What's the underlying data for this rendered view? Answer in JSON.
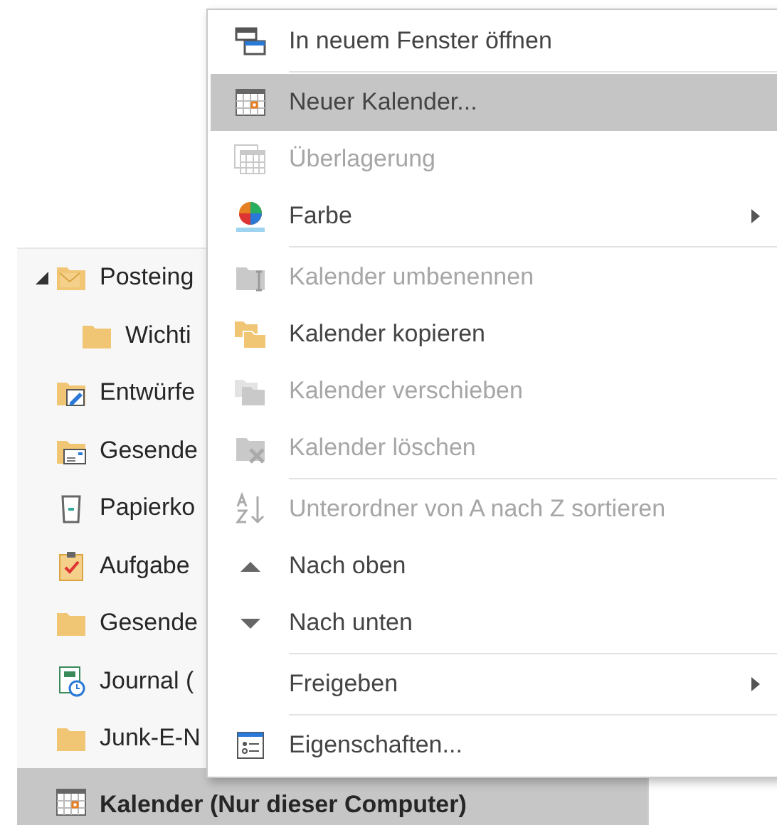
{
  "folder_pane": {
    "items": [
      {
        "label": "Posteing",
        "kind": "inbox",
        "expanded": true,
        "selected": false,
        "children": [
          {
            "label": "Wichti",
            "kind": "folder",
            "selected": false
          }
        ]
      },
      {
        "label": "Entwürfe",
        "kind": "drafts",
        "selected": false
      },
      {
        "label": "Gesende",
        "kind": "sent",
        "selected": false
      },
      {
        "label": "Papierko",
        "kind": "trash",
        "selected": false
      },
      {
        "label": "Aufgabe",
        "kind": "tasks",
        "selected": false
      },
      {
        "label": "Gesende",
        "kind": "folder",
        "selected": false
      },
      {
        "label": "Journal (",
        "kind": "journal",
        "selected": false
      },
      {
        "label": "Junk-E-N",
        "kind": "folder",
        "selected": false
      },
      {
        "label": "Kalender (Nur dieser Computer)",
        "kind": "calendar",
        "selected": true
      }
    ]
  },
  "context_menu": {
    "items": [
      {
        "kind": "window",
        "label": "In neuem Fenster öffnen",
        "disabled": false,
        "selected": false
      },
      {
        "kind": "separator"
      },
      {
        "kind": "calendar",
        "label": "Neuer Kalender...",
        "disabled": false,
        "selected": true
      },
      {
        "kind": "overlay",
        "label": "Überlagerung",
        "disabled": true,
        "selected": false
      },
      {
        "kind": "color",
        "label": "Farbe",
        "disabled": false,
        "selected": false,
        "submenu": true
      },
      {
        "kind": "separator"
      },
      {
        "kind": "rename",
        "label": "Kalender umbenennen",
        "disabled": true,
        "selected": false
      },
      {
        "kind": "copy",
        "label": "Kalender kopieren",
        "disabled": false,
        "selected": false
      },
      {
        "kind": "move",
        "label": "Kalender verschieben",
        "disabled": true,
        "selected": false
      },
      {
        "kind": "delete",
        "label": "Kalender löschen",
        "disabled": true,
        "selected": false
      },
      {
        "kind": "separator"
      },
      {
        "kind": "sort",
        "label": "Unterordner von A nach Z sortieren",
        "disabled": true,
        "selected": false
      },
      {
        "kind": "up",
        "label": "Nach oben",
        "disabled": false,
        "selected": false
      },
      {
        "kind": "down",
        "label": "Nach unten",
        "disabled": false,
        "selected": false
      },
      {
        "kind": "separator"
      },
      {
        "kind": "plain",
        "label": "Freigeben",
        "disabled": false,
        "selected": false,
        "submenu": true
      },
      {
        "kind": "separator"
      },
      {
        "kind": "properties",
        "label": "Eigenschaften...",
        "disabled": false,
        "selected": false
      }
    ]
  }
}
